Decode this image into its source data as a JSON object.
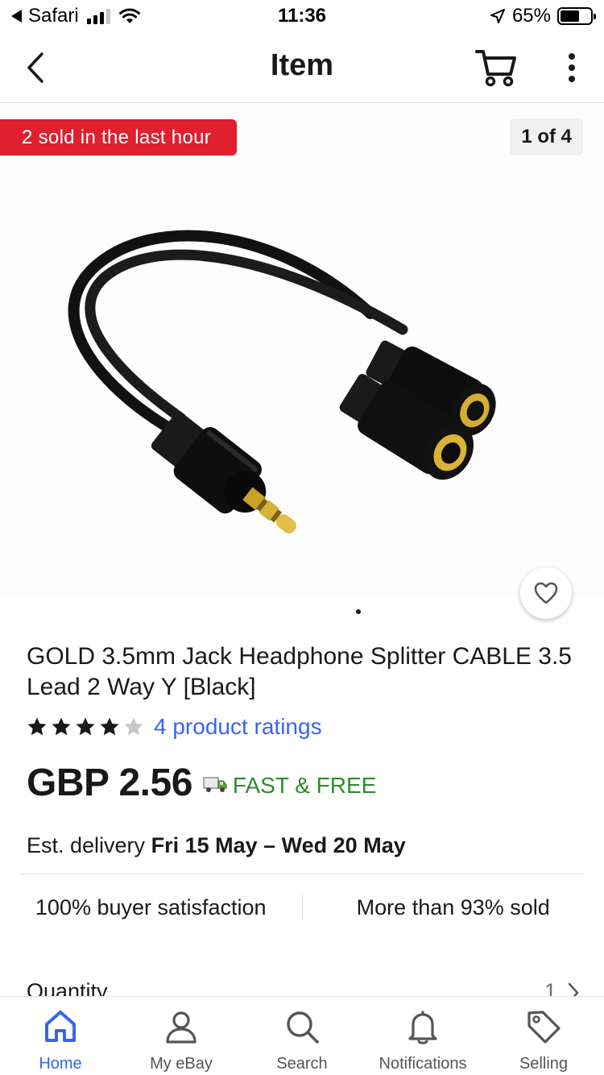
{
  "status_bar": {
    "back_app": "Safari",
    "time": "11:36",
    "battery": "65%",
    "battery_level": 0.65
  },
  "nav": {
    "title": "Item",
    "back_icon": "chevron-left-icon",
    "cart_icon": "cart-icon",
    "more_icon": "more-vertical-icon"
  },
  "gallery": {
    "badge": "2 sold in the last hour",
    "counter": "1 of 4",
    "image": "audio-splitter-cable-image",
    "current_page": 1,
    "total_pages": 4
  },
  "product": {
    "title": "GOLD 3.5mm Jack Headphone Splitter CABLE 3.5 Lead 2 Way Y [Black]",
    "rating_stars": 4,
    "rating_max": 5,
    "ratings_link": "4 product ratings",
    "price": "GBP 2.56",
    "shipping": "FAST & FREE",
    "delivery_prefix": "Est. delivery",
    "delivery_dates": "Fri 15 May – Wed 20 May"
  },
  "stats": {
    "left": "100% buyer satisfaction",
    "right": "More than 93% sold"
  },
  "quantity": {
    "label": "Quantity",
    "value": "1"
  },
  "tabs": [
    {
      "label": "Home",
      "icon": "home-icon",
      "active": true
    },
    {
      "label": "My eBay",
      "icon": "user-icon",
      "active": false
    },
    {
      "label": "Search",
      "icon": "search-icon",
      "active": false
    },
    {
      "label": "Notifications",
      "icon": "bell-icon",
      "active": false
    },
    {
      "label": "Selling",
      "icon": "tag-icon",
      "active": false
    }
  ],
  "colors": {
    "accent": "#3665f3",
    "badge": "#e0202f",
    "shipping": "#2e8b2e"
  }
}
